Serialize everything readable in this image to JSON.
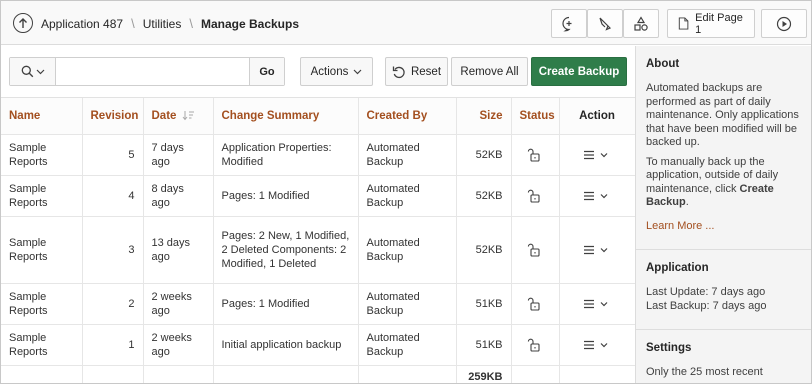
{
  "header": {
    "breadcrumbs": [
      "Application 487",
      "Utilities"
    ],
    "current": "Manage Backups",
    "edit_page_label": "Edit Page 1"
  },
  "toolbar": {
    "search_value": "",
    "go_label": "Go",
    "actions_label": "Actions",
    "reset_label": "Reset",
    "remove_all_label": "Remove All",
    "create_backup_label": "Create Backup"
  },
  "table": {
    "columns": {
      "name": "Name",
      "revision": "Revision",
      "date": "Date",
      "change_summary": "Change Summary",
      "created_by": "Created By",
      "size": "Size",
      "status": "Status",
      "action": "Action"
    },
    "rows": [
      {
        "name": "Sample Reports",
        "revision": "5",
        "date": "7 days ago",
        "change_summary": "Application Properties: Modified",
        "created_by": "Automated Backup",
        "size": "52KB"
      },
      {
        "name": "Sample Reports",
        "revision": "4",
        "date": "8 days ago",
        "change_summary": "Pages: 1 Modified",
        "created_by": "Automated Backup",
        "size": "52KB"
      },
      {
        "name": "Sample Reports",
        "revision": "3",
        "date": "13 days ago",
        "change_summary": "Pages: 2 New, 1 Modified, 2 Deleted Components: 2 Modified, 1 Deleted",
        "created_by": "Automated Backup",
        "size": "52KB"
      },
      {
        "name": "Sample Reports",
        "revision": "2",
        "date": "2 weeks ago",
        "change_summary": "Pages: 1 Modified",
        "created_by": "Automated Backup",
        "size": "51KB"
      },
      {
        "name": "Sample Reports",
        "revision": "1",
        "date": "2 weeks ago",
        "change_summary": "Initial application backup",
        "created_by": "Automated Backup",
        "size": "51KB"
      }
    ],
    "total_size": "259KB"
  },
  "sidebar": {
    "about": {
      "title": "About",
      "p1": "Automated backups are performed as part of daily maintenance. Only applications that have been modified will be backed up.",
      "p2_prefix": "To manually back up the application, outside of daily maintenance, click ",
      "p2_bold": "Create Backup",
      "p2_suffix": ".",
      "learn_more": "Learn More ..."
    },
    "application": {
      "title": "Application",
      "last_update": "Last Update: 7 days ago",
      "last_backup": "Last Backup: 7 days ago"
    },
    "settings": {
      "title": "Settings",
      "text": "Only the 25 most recent"
    }
  },
  "colors": {
    "accent": "#a34f1f",
    "primary_button": "#2f7d4a"
  }
}
